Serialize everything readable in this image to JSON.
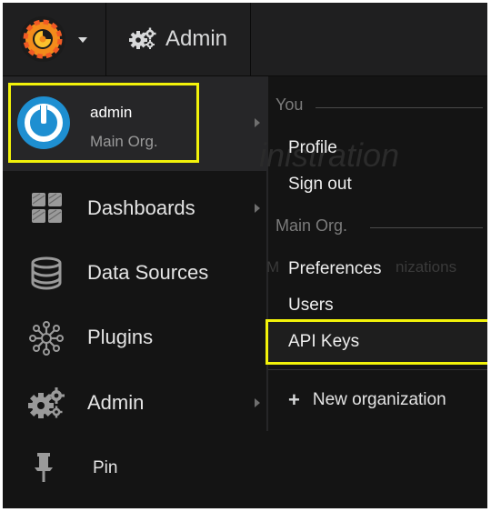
{
  "topbar": {
    "app_label": "Admin"
  },
  "user": {
    "name": "admin",
    "org": "Main Org."
  },
  "sidebar": {
    "items": [
      {
        "label": "Dashboards",
        "icon": "dashboards-grid-icon",
        "has_submenu": true
      },
      {
        "label": "Data Sources",
        "icon": "database-icon",
        "has_submenu": false
      },
      {
        "label": "Plugins",
        "icon": "plugins-icon",
        "has_submenu": false
      },
      {
        "label": "Admin",
        "icon": "gears-icon",
        "has_submenu": true
      },
      {
        "label": "Pin",
        "icon": "pin-icon",
        "has_submenu": false
      }
    ]
  },
  "dropdown": {
    "you_header": "You",
    "you_items": [
      "Profile",
      "Sign out"
    ],
    "org_header": "Main Org.",
    "org_items": [
      "Preferences",
      "Users",
      "API Keys"
    ],
    "new_org": "New organization"
  },
  "background_text": {
    "heading": "inistration",
    "line": "M",
    "line2": "nizations"
  },
  "colors": {
    "highlight": "#f2f20a",
    "background": "#141414",
    "panel": "#262628",
    "grafana_orange": "#f38b1b",
    "avatar_blue": "#1e8fd1"
  }
}
